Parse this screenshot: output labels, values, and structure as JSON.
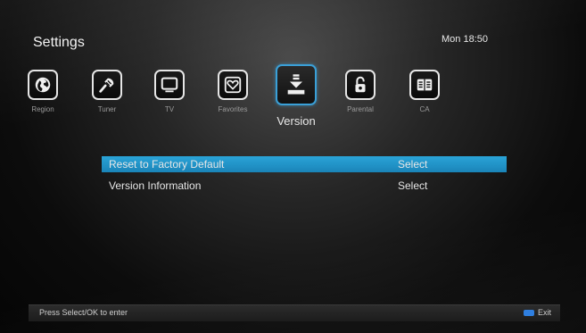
{
  "header": {
    "title": "Settings",
    "clock": "Mon 18:50"
  },
  "menu": {
    "items": [
      {
        "label": "Region",
        "icon": "globe-icon"
      },
      {
        "label": "Tuner",
        "icon": "satellite-dish-icon"
      },
      {
        "label": "TV",
        "icon": "tv-icon"
      },
      {
        "label": "Favorites",
        "icon": "heart-icon"
      },
      {
        "label": "Version",
        "icon": "download-icon",
        "active": true
      },
      {
        "label": "Parental",
        "icon": "lock-icon"
      },
      {
        "label": "CA",
        "icon": "card-icon"
      }
    ]
  },
  "list": {
    "rows": [
      {
        "label": "Reset to Factory Default",
        "action": "Select",
        "selected": true
      },
      {
        "label": "Version Information",
        "action": "Select",
        "selected": false
      }
    ]
  },
  "footer": {
    "hint": "Press Select/OK to enter",
    "exit_label": "Exit",
    "exit_key_color": "#2f7fe0"
  },
  "colors": {
    "accent": "#1f8fc4",
    "active_border": "#3aa0d8"
  }
}
